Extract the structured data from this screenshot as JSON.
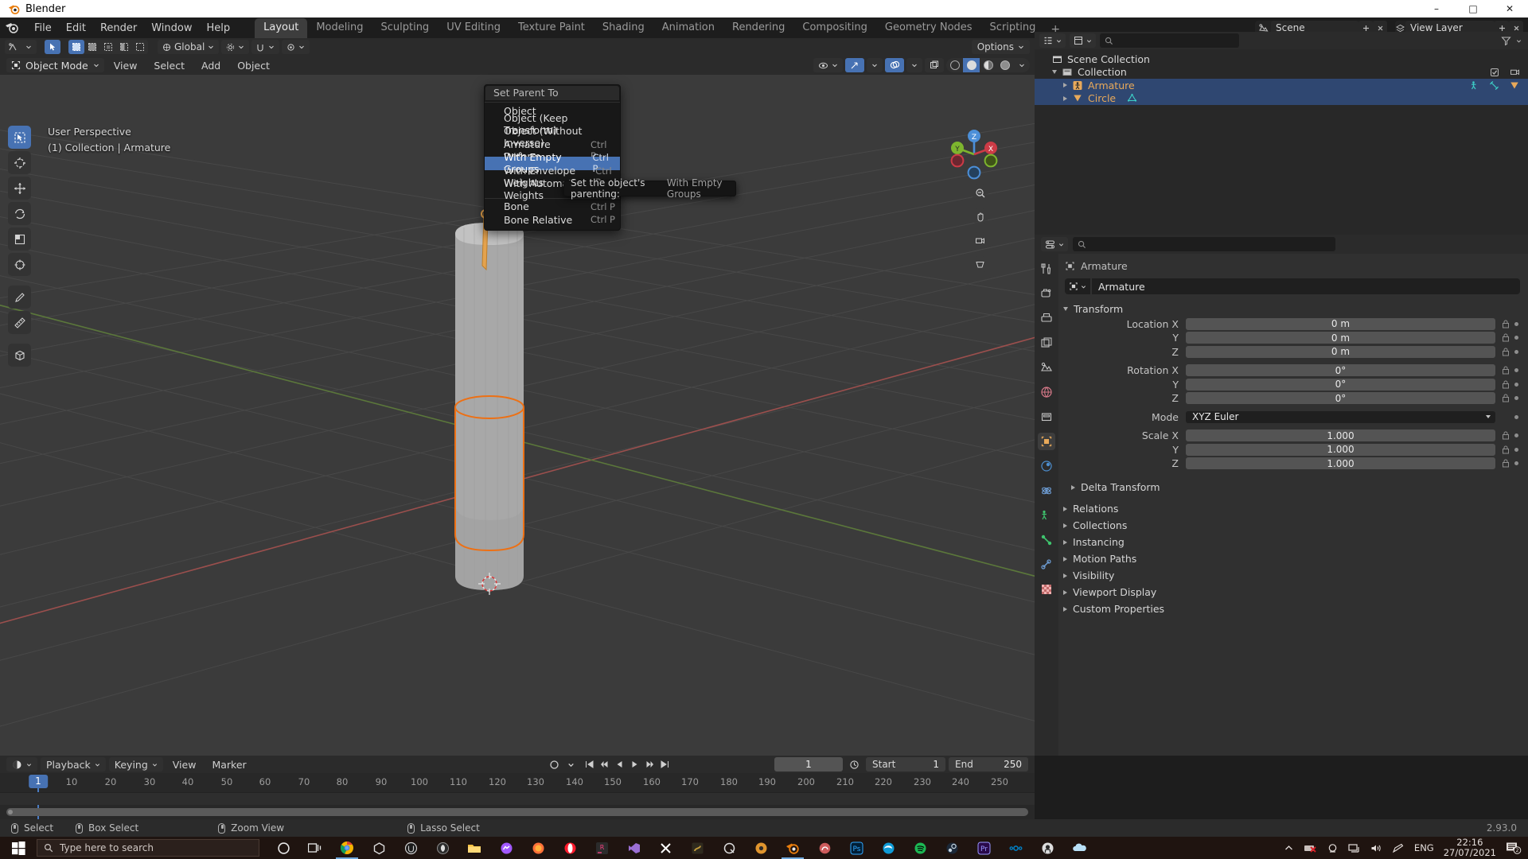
{
  "window": {
    "title": "Blender",
    "minimize": "–",
    "maximize": "□",
    "close": "✕"
  },
  "topbar": {
    "menus": [
      "File",
      "Edit",
      "Render",
      "Window",
      "Help"
    ],
    "workspaces": [
      "Layout",
      "Modeling",
      "Sculpting",
      "UV Editing",
      "Texture Paint",
      "Shading",
      "Animation",
      "Rendering",
      "Compositing",
      "Geometry Nodes",
      "Scripting"
    ],
    "active_workspace": "Layout",
    "add_workspace": "+",
    "scene_name": "Scene",
    "view_layer_name": "View Layer",
    "scene_icon": "scene-icon",
    "view_layer_icon": "view-layer-icon"
  },
  "tool_header": {
    "transform_orientation": "Global",
    "snap_label": "snapping",
    "proportional_label": "proportional-editing",
    "options_label": "Options"
  },
  "viewport": {
    "mode": "Object Mode",
    "menus": [
      "View",
      "Select",
      "Add",
      "Object"
    ],
    "overlay_line1": "User Perspective",
    "overlay_line2": "(1) Collection | Armature",
    "gizmo_axes": {
      "x": "X",
      "y": "Y",
      "z": "Z"
    },
    "left_tools": [
      "select-box-tool",
      "cursor-tool",
      "move-tool",
      "rotate-tool",
      "scale-tool",
      "transform-tool",
      "annotate-tool",
      "measure-tool",
      "add-cube-tool"
    ],
    "nav_icons": [
      "zoom-navigate-icon",
      "pan-hand-icon",
      "camera-view-icon",
      "perspective-toggle-icon"
    ]
  },
  "context_menu": {
    "title": "Set Parent To",
    "items": [
      {
        "label": "Object",
        "shortcut": "",
        "underline": "O",
        "highlighted": false
      },
      {
        "label": "Object (Keep Transform)",
        "shortcut": "",
        "underline": "K",
        "highlighted": false
      },
      {
        "label": "Object (Without Inverse)",
        "shortcut": "",
        "underline": "W",
        "highlighted": false
      },
      {
        "label": "Armature Deform",
        "shortcut": "Ctrl P",
        "underline": "A",
        "highlighted": false
      },
      {
        "label": "With Empty Groups",
        "shortcut": "Ctrl P",
        "underline": "E",
        "highlighted": true
      },
      {
        "label": "With Envelope Weights",
        "shortcut": "Ctrl P",
        "underline": "i",
        "highlighted": false
      },
      {
        "label": "With Automatic Weights",
        "shortcut": "Ctrl P",
        "underline": "t",
        "highlighted": false
      },
      {
        "label": "Bone",
        "shortcut": "Ctrl P",
        "underline": "B",
        "highlighted": false
      },
      {
        "label": "Bone Relative",
        "shortcut": "Ctrl P",
        "underline": "",
        "highlighted": false
      }
    ]
  },
  "tooltip": {
    "text": "Set the object's parenting:",
    "value": "With Empty Groups"
  },
  "outliner": {
    "display_mode_icon": "outliner-display-mode-icon",
    "filter_icon": "filter-icon",
    "search_placeholder": "",
    "rows": [
      {
        "name": "Scene Collection",
        "type": "scene",
        "indent": 0,
        "selected": false,
        "expand": "none",
        "icons": []
      },
      {
        "name": "Collection",
        "type": "collection",
        "indent": 1,
        "selected": false,
        "expand": "down",
        "icons": [
          "checkbox",
          "camera"
        ]
      },
      {
        "name": "Armature",
        "type": "object",
        "indent": 2,
        "selected": true,
        "expand": "right",
        "icons": [
          "pose-icon",
          "armature-data-icon",
          "modifier-icon",
          "eye",
          "camera"
        ]
      },
      {
        "name": "Circle",
        "type": "object",
        "indent": 2,
        "selected": true,
        "expand": "right",
        "icons": [
          "mesh-data-icon"
        ]
      }
    ]
  },
  "properties": {
    "search_placeholder": "",
    "breadcrumb": "Armature",
    "object_name": "Armature",
    "tabs": [
      "tool-tab",
      "render-tab",
      "output-tab",
      "view-layer-tab",
      "scene-tab",
      "world-tab",
      "collection-tab",
      "object-tab",
      "modifier-tab",
      "physics-tab",
      "constraint-tab",
      "object-data-tab",
      "bone-tab",
      "bone-constraint-tab",
      "material-tab"
    ],
    "active_tab": "object-tab",
    "transform": {
      "title": "Transform",
      "rows": [
        {
          "label": "Location X",
          "value": "0 m"
        },
        {
          "label": "Y",
          "value": "0 m"
        },
        {
          "label": "Z",
          "value": "0 m"
        },
        {
          "label": "Rotation X",
          "value": "0°"
        },
        {
          "label": "Y",
          "value": "0°"
        },
        {
          "label": "Z",
          "value": "0°"
        },
        {
          "label": "Mode",
          "value": "XYZ Euler",
          "dropdown": true
        },
        {
          "label": "Scale X",
          "value": "1.000"
        },
        {
          "label": "Y",
          "value": "1.000"
        },
        {
          "label": "Z",
          "value": "1.000"
        }
      ]
    },
    "sub_panels": [
      "Delta Transform"
    ],
    "panels": [
      "Relations",
      "Collections",
      "Instancing",
      "Motion Paths",
      "Visibility",
      "Viewport Display",
      "Custom Properties"
    ]
  },
  "timeline": {
    "editor_icon": "timeline-editor-icon",
    "menus_dropdowns": [
      "Playback",
      "Keying"
    ],
    "menus": [
      "View",
      "Marker"
    ],
    "current_frame": "1",
    "start_label": "Start",
    "start_value": "1",
    "end_label": "End",
    "end_value": "250",
    "ticks": [
      "10",
      "20",
      "30",
      "40",
      "50",
      "60",
      "70",
      "80",
      "90",
      "100",
      "110",
      "120",
      "130",
      "140",
      "150",
      "160",
      "170",
      "180",
      "190",
      "200",
      "210",
      "220",
      "230",
      "240",
      "250"
    ],
    "playhead_label": "1",
    "transport": [
      "jump-start",
      "prev-keyframe",
      "play-reverse",
      "play",
      "next-keyframe",
      "jump-end"
    ],
    "record_icon": "record-icon",
    "auto_key_icon": "auto-keying-icon"
  },
  "statusbar": {
    "items": [
      {
        "icon": "mouse-left-icon",
        "label": "Select"
      },
      {
        "icon": "mouse-left-drag-icon",
        "label": "Box Select"
      },
      {
        "icon": "mouse-middle-icon",
        "label": "Zoom View"
      },
      {
        "icon": "mouse-left-drag-icon",
        "label": "Lasso Select"
      }
    ],
    "version": "2.93.0"
  },
  "taskbar": {
    "search_placeholder": "Type here to search",
    "language": "ENG",
    "time": "22:16",
    "date": "27/07/2021",
    "notification_count": "2",
    "apps": [
      {
        "name": "cortana-icon",
        "color": "#e8e8e8"
      },
      {
        "name": "task-view-icon",
        "color": "#e8e8e8"
      },
      {
        "name": "chrome-icon",
        "color": "#4285f4"
      },
      {
        "name": "unity-icon",
        "color": "#dddddd"
      },
      {
        "name": "unreal-icon",
        "color": "#cccccc"
      },
      {
        "name": "unreal-engine-icon",
        "color": "#2a2a2a"
      },
      {
        "name": "file-explorer-icon",
        "color": "#f5c142"
      },
      {
        "name": "messenger-icon",
        "color": "#a259ff"
      },
      {
        "name": "firefox-icon",
        "color": "#ff7139"
      },
      {
        "name": "opera-icon",
        "color": "#ff1b2d"
      },
      {
        "name": "rider-icon",
        "color": "#f5417f"
      },
      {
        "name": "visual-studio-icon",
        "color": "#5c2d91"
      },
      {
        "name": "xsplit-icon",
        "color": "#ffffff"
      },
      {
        "name": "substance-icon",
        "color": "#c19a3b"
      },
      {
        "name": "quixel-icon",
        "color": "#dddddd"
      },
      {
        "name": "mixer-icon",
        "color": "#e0952e"
      },
      {
        "name": "blender-icon",
        "color": "#e87d0d"
      },
      {
        "name": "krita-icon",
        "color": "#cd5c5c"
      },
      {
        "name": "photoshop-icon",
        "color": "#31a8ff"
      },
      {
        "name": "edge-icon",
        "color": "#0f9bd7"
      },
      {
        "name": "spotify-icon",
        "color": "#1db954"
      },
      {
        "name": "steam-icon",
        "color": "#c7d5e0"
      },
      {
        "name": "premiere-icon",
        "color": "#9999ff"
      },
      {
        "name": "nextcloud-icon",
        "color": "#0082c9"
      },
      {
        "name": "github-icon",
        "color": "#dddddd"
      },
      {
        "name": "onedrive-icon",
        "color": "#0078d4"
      }
    ],
    "tray": [
      "chevron-up-icon",
      "antivirus-icon",
      "webcam-icon",
      "network-icon",
      "volume-icon",
      "pen-icon"
    ]
  }
}
